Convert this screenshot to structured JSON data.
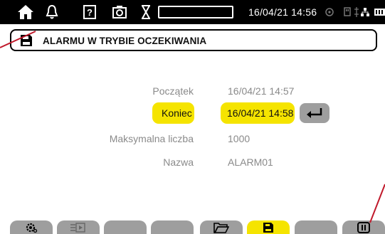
{
  "status_bar": {
    "datetime": "16/04/21 14:56",
    "icons": [
      "home-icon",
      "bell-icon",
      "help-icon",
      "camera-icon",
      "hourglass-icon",
      "target-icon",
      "usb-icon",
      "network-icon",
      "battery-icon"
    ],
    "progress": 0
  },
  "title_bar": {
    "icon": "save-icon",
    "title": "ALARMU W TRYBIE OCZEKIWANIA"
  },
  "form": {
    "start": {
      "label": "Początek",
      "value": "16/04/21 14:57"
    },
    "end": {
      "label": "Koniec",
      "value": "16/04/21 14:58"
    },
    "max_count": {
      "label": "Maksymalna liczba",
      "value": "1000"
    },
    "name": {
      "label": "Nazwa",
      "value": "ALARM01"
    }
  },
  "softkeys": [
    {
      "id": "settings",
      "icon": "gear-icon",
      "active": false
    },
    {
      "id": "transfer",
      "icon": "transfer-icon",
      "active": false
    },
    {
      "id": "empty1",
      "icon": "",
      "active": false
    },
    {
      "id": "empty2",
      "icon": "",
      "active": false
    },
    {
      "id": "open",
      "icon": "folder-icon",
      "active": false
    },
    {
      "id": "save",
      "icon": "save-icon",
      "active": true
    },
    {
      "id": "empty3",
      "icon": "",
      "active": false
    },
    {
      "id": "pause",
      "icon": "pause-icon",
      "active": false
    }
  ],
  "colors": {
    "highlight": "#f5e400",
    "softkey": "#9e9e9e",
    "annotation": "#c0192b",
    "bar": "#000000"
  }
}
